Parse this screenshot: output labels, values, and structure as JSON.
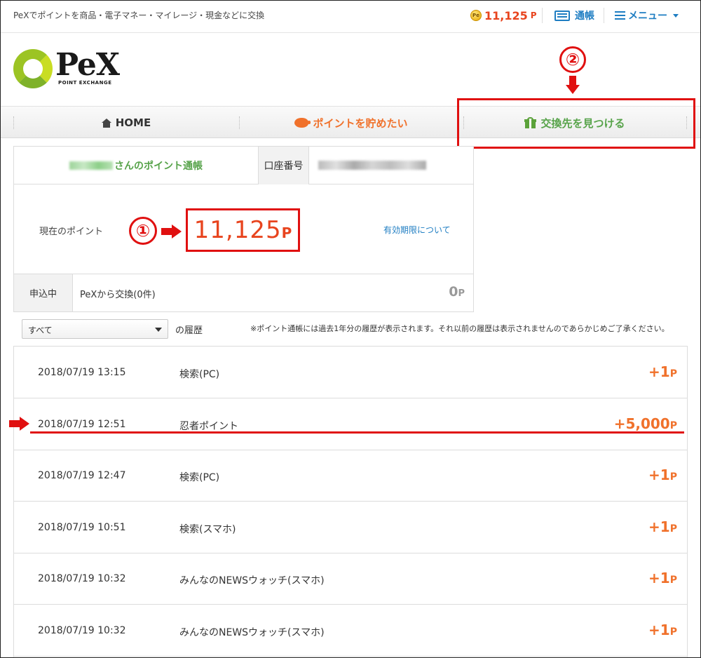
{
  "header": {
    "tagline": "PeXでポイントを商品・電子マネー・マイレージ・現金などに交換",
    "points": "11,125",
    "points_unit": "P",
    "coin_label": "Pe",
    "passbook_label": "通帳",
    "menu_label": "メニュー"
  },
  "logo": {
    "text": "PeX",
    "sub": "POINT EXCHANGE"
  },
  "annotations": {
    "marker1": "①",
    "marker2": "②"
  },
  "nav": {
    "home": "HOME",
    "save": "ポイントを貯めたい",
    "exchange": "交換先を見つける"
  },
  "account": {
    "owner_suffix": "さんのポイント通帳",
    "account_label": "口座番号",
    "current_label": "現在のポイント",
    "current_points": "11,125",
    "current_unit": "P",
    "expiry_link": "有効期限について",
    "pending_label": "申込中",
    "pending_text": "PeXから交換(0件)",
    "pending_points": "0",
    "pending_unit": "P"
  },
  "filter": {
    "selected": "すべて",
    "history_label": "の履歴",
    "note": "※ポイント通帳には過去1年分の履歴が表示されます。それ以前の履歴は表示されませんのであらかじめご了承ください。"
  },
  "history": [
    {
      "date": "2018/07/19 13:15",
      "desc": "検索(PC)",
      "points": "+1",
      "unit": "P"
    },
    {
      "date": "2018/07/19 12:51",
      "desc": "忍者ポイント",
      "points": "+5,000",
      "unit": "P"
    },
    {
      "date": "2018/07/19 12:47",
      "desc": "検索(PC)",
      "points": "+1",
      "unit": "P"
    },
    {
      "date": "2018/07/19 10:51",
      "desc": "検索(スマホ)",
      "points": "+1",
      "unit": "P"
    },
    {
      "date": "2018/07/19 10:32",
      "desc": "みんなのNEWSウォッチ(スマホ)",
      "points": "+1",
      "unit": "P"
    },
    {
      "date": "2018/07/19 10:32",
      "desc": "みんなのNEWSウォッチ(スマホ)",
      "points": "+1",
      "unit": "P"
    }
  ],
  "colors": {
    "accent_orange": "#e8441e",
    "link_blue": "#1e7dc2",
    "brand_green": "#57a34a",
    "annotation_red": "#e01010"
  },
  "icons": [
    "coin-icon",
    "passbook-icon",
    "menu-icon",
    "home-icon",
    "piggy-bank-icon",
    "gift-icon",
    "arrow-down-icon",
    "arrow-right-icon"
  ]
}
